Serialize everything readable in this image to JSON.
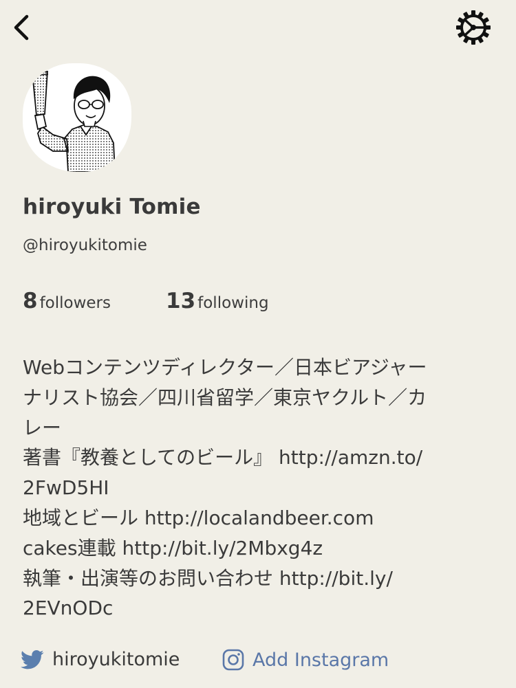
{
  "header": {
    "back_icon": "chevron-left-icon",
    "settings_icon": "gear-icon"
  },
  "profile": {
    "avatar_icon": "user-illustration",
    "display_name": "hiroyuki Tomie",
    "handle": "@hiroyukitomie",
    "followers_count": "8",
    "followers_label": "followers",
    "following_count": "13",
    "following_label": "following",
    "bio_lines": [
      "Webコンテンツディレクター／日本ビアジャー",
      "ナリスト協会／四川省留学／東京ヤクルト／カ",
      "レー",
      "著書『教養としてのビール』 http://amzn.to/",
      "2FwD5HI",
      "地域とビール http://localandbeer.com",
      "cakes連載 http://bit.ly/2Mbxg4z",
      "執筆・出演等のお問い合わせ http://bit.ly/",
      "2EVnODc"
    ]
  },
  "socials": {
    "twitter_handle": "hiroyukitomie",
    "instagram_label": "Add Instagram",
    "twitter_color": "#5b7fae",
    "instagram_color": "#5a77a8"
  }
}
